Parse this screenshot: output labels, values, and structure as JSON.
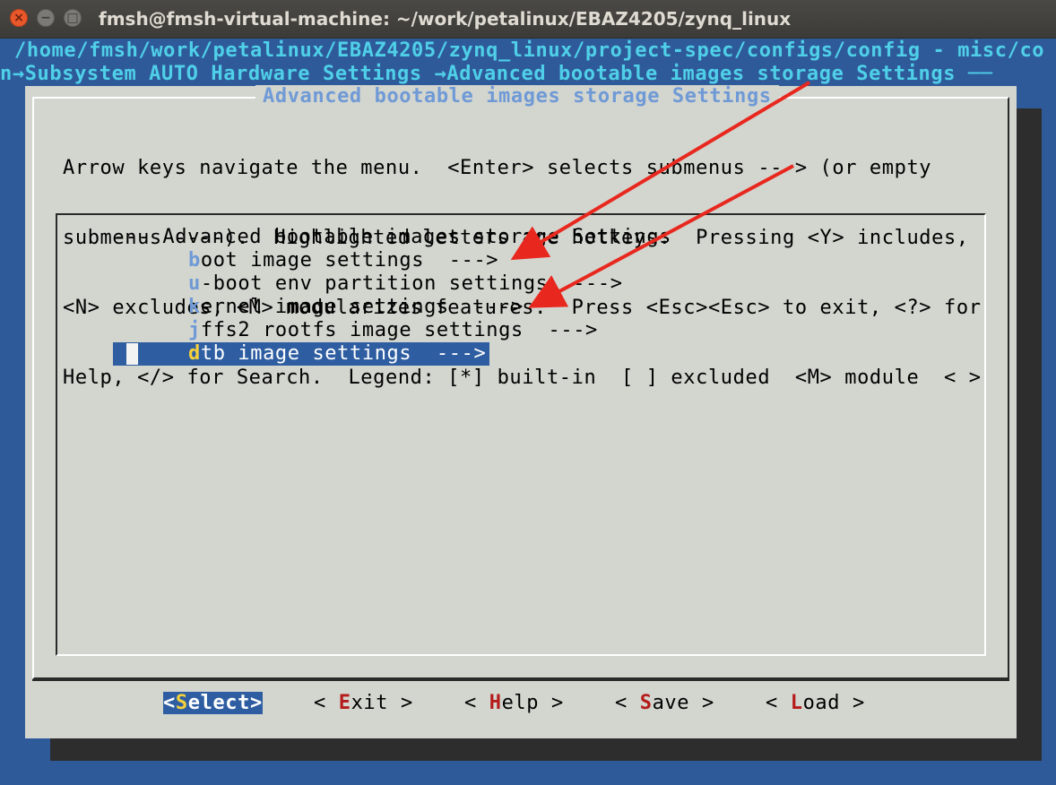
{
  "window": {
    "title": "fmsh@fmsh-virtual-machine: ~/work/petalinux/EBAZ4205/zynq_linux",
    "close_glyph": "×",
    "minimize_glyph": "−",
    "maximize_glyph": "□"
  },
  "terminal": {
    "path_line": "/home/fmsh/work/petalinux/EBAZ4205/zynq_linux/project-spec/configs/config - misc/co",
    "breadcrumb_line": "n→Subsystem AUTO Hardware Settings →Advanced bootable images storage Settings ──"
  },
  "dialog": {
    "title": "Advanced bootable images storage Settings",
    "help_lines": [
      "Arrow keys navigate the menu.  <Enter> selects submenus ---> (or empty",
      "submenus ----).  Highlighted letters are hotkeys.  Pressing <Y> includes,",
      "<N> excludes, <M> modularizes features.  Press <Esc><Esc> to exit, <?> for",
      "Help, </> for Search.  Legend: [*] built-in  [ ] excluded  <M> module  < >"
    ],
    "menu_header": "--- Advanced bootable images storage Settings",
    "items": [
      {
        "hotkey": "b",
        "rest": "oot image settings  --->"
      },
      {
        "hotkey": "u",
        "rest": "-boot env partition settings  --->"
      },
      {
        "hotkey": "k",
        "rest": "ernel image settings  --->"
      },
      {
        "hotkey": "j",
        "rest": "ffs2 rootfs image settings  --->"
      },
      {
        "hotkey": "d",
        "rest": "tb image settings  --->"
      }
    ],
    "selected_index": 4,
    "buttons": [
      {
        "pre": "<",
        "hk": "S",
        "post": "elect>"
      },
      {
        "pre": "< ",
        "hk": "E",
        "post": "xit >"
      },
      {
        "pre": "< ",
        "hk": "H",
        "post": "elp >"
      },
      {
        "pre": "< ",
        "hk": "S",
        "post": "ave >"
      },
      {
        "pre": "< ",
        "hk": "L",
        "post": "oad >"
      }
    ]
  },
  "colors": {
    "desktop": "#2f5a9a",
    "dialog_bg": "#d3d5cf",
    "highlight": "#2e5ea1",
    "hotkey_blue": "#6f9ad6",
    "hotkey_red": "#b51b1b",
    "hotkey_yellow": "#f5d03b",
    "arrow_red": "#e8281e"
  }
}
